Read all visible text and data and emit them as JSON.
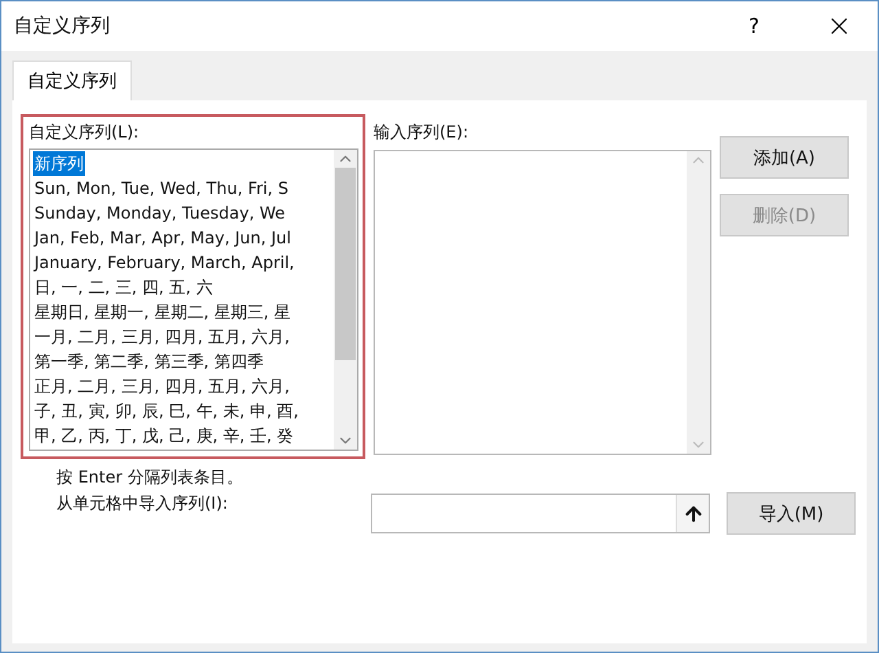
{
  "window": {
    "title": "自定义序列",
    "help": "?"
  },
  "tabs": [
    {
      "label": "自定义序列",
      "selected": true
    }
  ],
  "custom_lists": {
    "label": "自定义序列(L):",
    "items": [
      {
        "text": "新序列",
        "selected": true
      },
      {
        "text": "Sun, Mon, Tue, Wed, Thu, Fri, S",
        "selected": false
      },
      {
        "text": "Sunday, Monday, Tuesday, We",
        "selected": false
      },
      {
        "text": "Jan, Feb, Mar, Apr, May, Jun, Jul",
        "selected": false
      },
      {
        "text": "January, February, March, April,",
        "selected": false
      },
      {
        "text": "日, 一, 二, 三, 四, 五, 六",
        "selected": false
      },
      {
        "text": "星期日, 星期一, 星期二, 星期三, 星",
        "selected": false
      },
      {
        "text": "一月, 二月, 三月, 四月, 五月, 六月,",
        "selected": false
      },
      {
        "text": "第一季, 第二季, 第三季, 第四季",
        "selected": false
      },
      {
        "text": "正月, 二月, 三月, 四月, 五月, 六月,",
        "selected": false
      },
      {
        "text": "子, 丑, 寅, 卯, 辰, 巳, 午, 未, 申, 酉,",
        "selected": false
      },
      {
        "text": "甲, 乙, 丙, 丁, 戊, 己, 庚, 辛, 壬, 癸",
        "selected": false
      }
    ]
  },
  "entries": {
    "label": "输入序列(E):"
  },
  "buttons": [
    {
      "label": "添加(A)",
      "disabled": false
    },
    {
      "label": "删除(D)",
      "disabled": true
    }
  ],
  "hint": "按 Enter 分隔列表条目。",
  "import": {
    "label": "从单元格中导入序列(I):",
    "button": "导入(M)"
  }
}
